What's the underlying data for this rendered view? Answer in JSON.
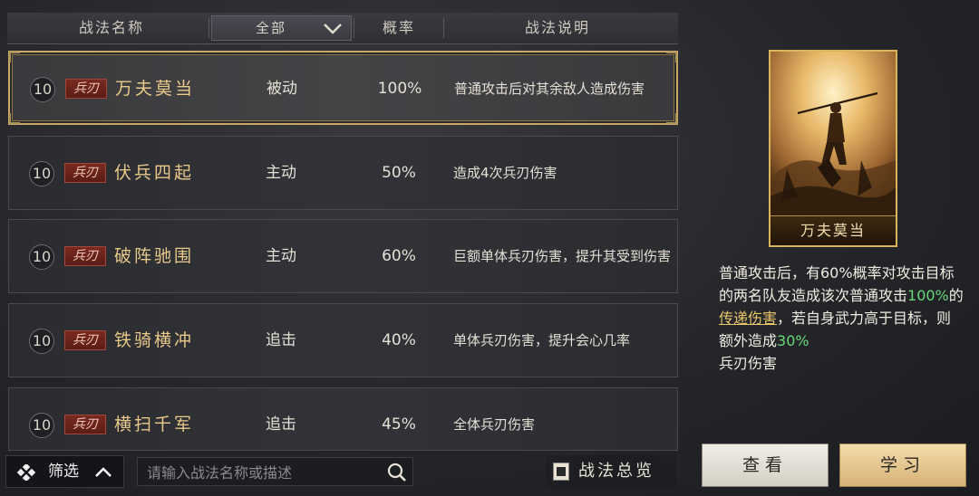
{
  "header": {
    "name_col": "战法名称",
    "filter_value": "全部",
    "rate_col": "概率",
    "desc_col": "战法说明"
  },
  "rows": [
    {
      "level": "10",
      "tag": "兵刃",
      "name": "万夫莫当",
      "type": "被动",
      "rate": "100%",
      "desc": "普通攻击后对其余敌人造成伤害",
      "selected": true
    },
    {
      "level": "10",
      "tag": "兵刃",
      "name": "伏兵四起",
      "type": "主动",
      "rate": "50%",
      "desc": "造成4次兵刃伤害"
    },
    {
      "level": "10",
      "tag": "兵刃",
      "name": "破阵驰围",
      "type": "主动",
      "rate": "60%",
      "desc": "巨额单体兵刃伤害，提升其受到伤害"
    },
    {
      "level": "10",
      "tag": "兵刃",
      "name": "铁骑横冲",
      "type": "追击",
      "rate": "40%",
      "desc": "单体兵刃伤害，提升会心几率"
    },
    {
      "level": "10",
      "tag": "兵刃",
      "name": "横扫千军",
      "type": "追击",
      "rate": "45%",
      "desc": "全体兵刃伤害"
    }
  ],
  "bottom": {
    "filter_label": "筛选",
    "search_placeholder": "请输入战法名称或描述",
    "overview_label": "战法总览"
  },
  "detail": {
    "card_title": "万夫莫当",
    "t1": "普通攻击后，有60%概率对攻击目标的两名队友造成该次普通攻击",
    "t2": "100%",
    "t3": "的",
    "t4": "传递伤害",
    "t5": "，若自身武力高于目标，则额外造成",
    "t6": "30%",
    "t7": "兵刃伤害"
  },
  "buttons": {
    "view": "查看",
    "learn": "学习"
  },
  "colors": {
    "accent_gold": "#c9a865",
    "highlight_green": "#67d97a",
    "tag_red": "#7a2a20"
  }
}
